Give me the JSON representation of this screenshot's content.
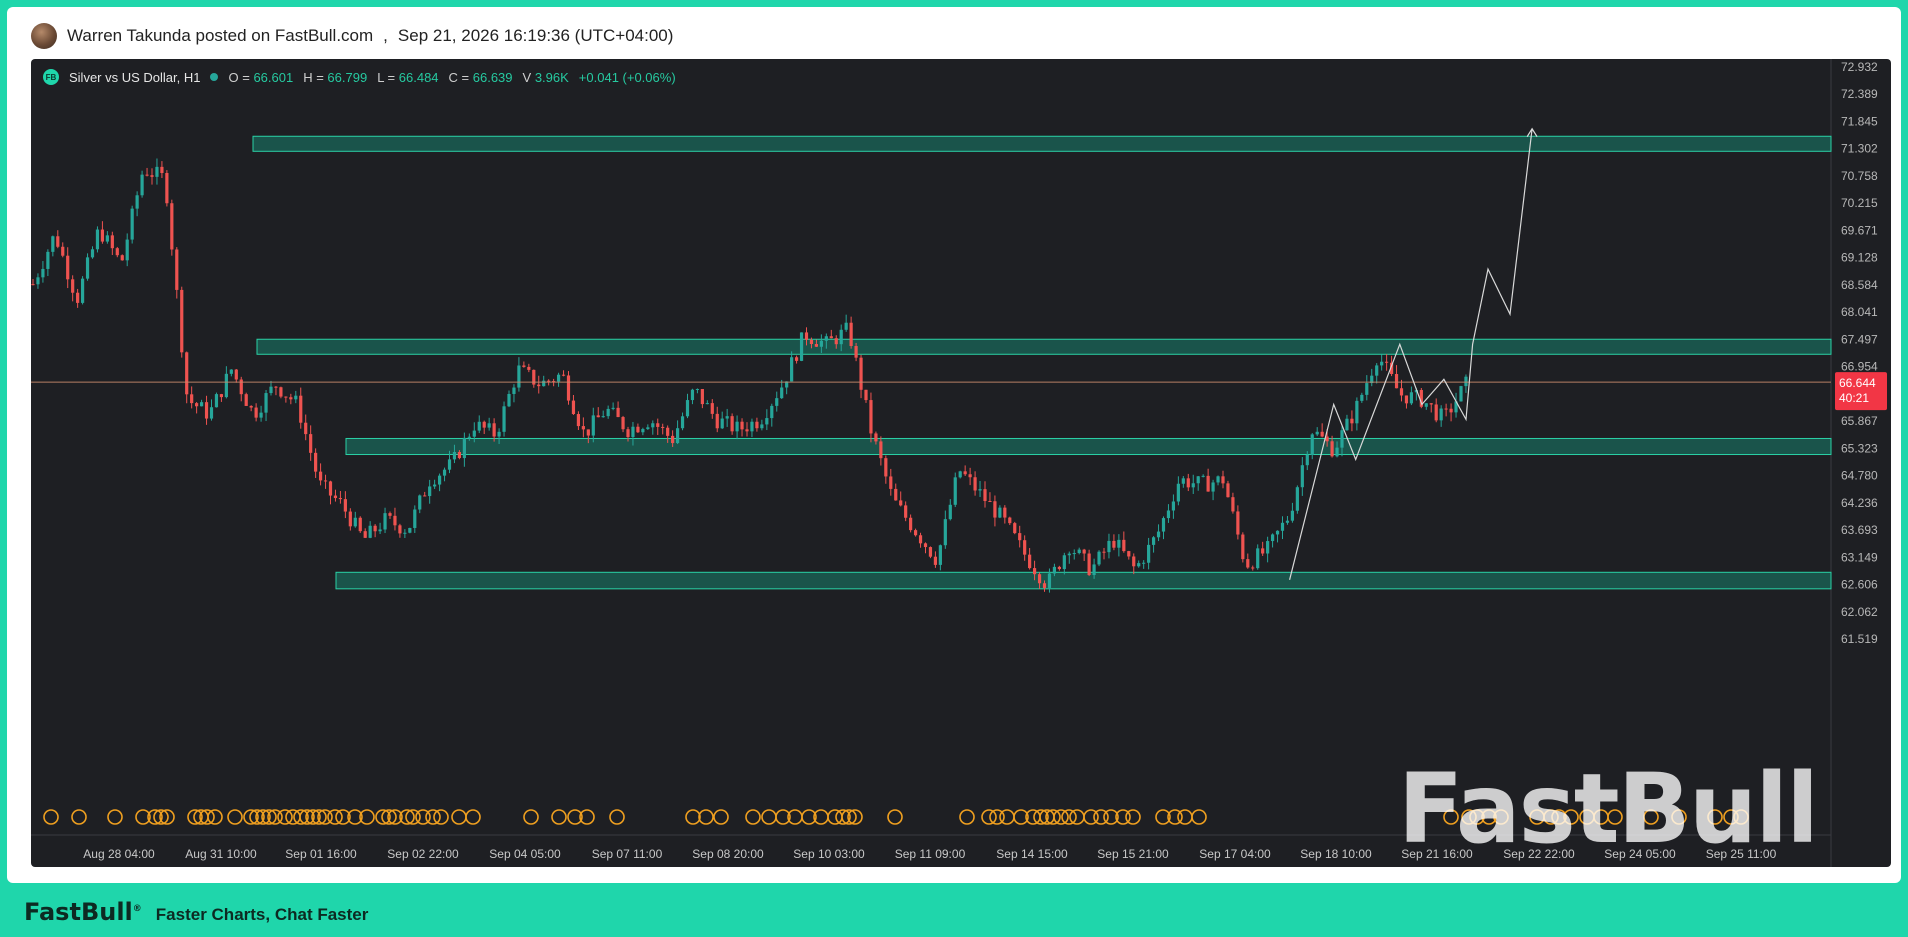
{
  "post": {
    "author_line": "Warren Takunda posted on FastBull.com",
    "separator": ",",
    "timestamp": "Sep 21, 2026 16:19:36 (UTC+04:00)"
  },
  "legend": {
    "badge": "FB",
    "symbol": "Silver vs US Dollar, H1",
    "o_label": "O =",
    "o_value": "66.601",
    "h_label": "H =",
    "h_value": "66.799",
    "l_label": "L =",
    "l_value": "66.484",
    "c_label": "C =",
    "c_value": "66.639",
    "v_label": "V",
    "v_value": "3.96K",
    "change": "+0.041 (+0.06%)"
  },
  "price_badge": {
    "price": "66.644",
    "countdown": "40:21",
    "color": "#f23645"
  },
  "watermark": "FastBull",
  "footer": {
    "logo": "FastBull",
    "logo_mark": "®",
    "tagline": "Faster Charts, Chat Faster"
  },
  "colors": {
    "up": "#26a69a",
    "down": "#ef5350",
    "zone_fill": "#1a5e52",
    "zone_stroke": "#2ad1a6",
    "event_icon": "#f0a020",
    "background": "#1e1f23"
  },
  "chart_data": {
    "type": "candlestick",
    "title": "Silver vs US Dollar, H1",
    "y_ticks": [
      "72.932",
      "72.389",
      "71.845",
      "71.302",
      "70.758",
      "70.215",
      "69.671",
      "69.128",
      "68.584",
      "68.041",
      "67.497",
      "66.954",
      "65.867",
      "65.323",
      "64.780",
      "64.236",
      "63.693",
      "63.149",
      "62.606",
      "62.062",
      "61.519"
    ],
    "ylim": [
      61.2,
      73.0
    ],
    "x_labels": [
      "Aug 28 04:00",
      "Aug 31 10:00",
      "Sep 01 16:00",
      "Sep 02 22:00",
      "Sep 04 05:00",
      "Sep 07 11:00",
      "Sep 08 20:00",
      "Sep 10 03:00",
      "Sep 11 09:00",
      "Sep 14 15:00",
      "Sep 15 21:00",
      "Sep 17 04:00",
      "Sep 18 10:00",
      "Sep 21 16:00",
      "Sep 22 22:00",
      "Sep 24 05:00",
      "Sep 25 11:00"
    ],
    "last_ohlc": {
      "open": 66.601,
      "high": 66.799,
      "low": 66.484,
      "close": 66.639
    },
    "current_price": 66.644,
    "price_path": [
      {
        "x": 0,
        "y": 68.6
      },
      {
        "x": 1,
        "y": 69.6
      },
      {
        "x": 2,
        "y": 68.3
      },
      {
        "x": 3,
        "y": 69.7
      },
      {
        "x": 4,
        "y": 69.0
      },
      {
        "x": 5,
        "y": 70.9
      },
      {
        "x": 6,
        "y": 70.7
      },
      {
        "x": 7,
        "y": 66.3
      },
      {
        "x": 8,
        "y": 66.0
      },
      {
        "x": 9,
        "y": 66.9
      },
      {
        "x": 10,
        "y": 66.0
      },
      {
        "x": 11,
        "y": 66.6
      },
      {
        "x": 12,
        "y": 66.2
      },
      {
        "x": 13,
        "y": 64.6
      },
      {
        "x": 14,
        "y": 64.2
      },
      {
        "x": 15,
        "y": 63.5
      },
      {
        "x": 16,
        "y": 63.9
      },
      {
        "x": 17,
        "y": 63.7
      },
      {
        "x": 18,
        "y": 64.7
      },
      {
        "x": 19,
        "y": 65.0
      },
      {
        "x": 20,
        "y": 65.8
      },
      {
        "x": 21,
        "y": 65.6
      },
      {
        "x": 22,
        "y": 66.9
      },
      {
        "x": 23,
        "y": 66.6
      },
      {
        "x": 24,
        "y": 66.8
      },
      {
        "x": 25,
        "y": 65.6
      },
      {
        "x": 26,
        "y": 66.1
      },
      {
        "x": 27,
        "y": 65.7
      },
      {
        "x": 28,
        "y": 65.9
      },
      {
        "x": 29,
        "y": 65.5
      },
      {
        "x": 30,
        "y": 66.5
      },
      {
        "x": 31,
        "y": 65.9
      },
      {
        "x": 32,
        "y": 65.7
      },
      {
        "x": 33,
        "y": 65.9
      },
      {
        "x": 34,
        "y": 66.6
      },
      {
        "x": 35,
        "y": 67.6
      },
      {
        "x": 36,
        "y": 67.4
      },
      {
        "x": 37,
        "y": 67.7
      },
      {
        "x": 38,
        "y": 65.7
      },
      {
        "x": 39,
        "y": 64.3
      },
      {
        "x": 40,
        "y": 63.7
      },
      {
        "x": 41,
        "y": 63.1
      },
      {
        "x": 42,
        "y": 64.9
      },
      {
        "x": 43,
        "y": 64.4
      },
      {
        "x": 44,
        "y": 63.9
      },
      {
        "x": 45,
        "y": 63.2
      },
      {
        "x": 46,
        "y": 62.6
      },
      {
        "x": 47,
        "y": 63.4
      },
      {
        "x": 48,
        "y": 62.9
      },
      {
        "x": 49,
        "y": 63.5
      },
      {
        "x": 50,
        "y": 62.9
      },
      {
        "x": 51,
        "y": 63.6
      },
      {
        "x": 52,
        "y": 64.7
      },
      {
        "x": 53,
        "y": 64.6
      },
      {
        "x": 54,
        "y": 64.7
      },
      {
        "x": 55,
        "y": 63.0
      },
      {
        "x": 56,
        "y": 63.3
      },
      {
        "x": 57,
        "y": 64.0
      },
      {
        "x": 58,
        "y": 65.7
      },
      {
        "x": 59,
        "y": 65.3
      },
      {
        "x": 60,
        "y": 66.1
      },
      {
        "x": 61,
        "y": 67.2
      },
      {
        "x": 62,
        "y": 66.4
      },
      {
        "x": 63,
        "y": 66.3
      },
      {
        "x": 64,
        "y": 65.9
      },
      {
        "x": 65,
        "y": 66.6
      }
    ],
    "zones": [
      {
        "low": 71.25,
        "high": 71.55
      },
      {
        "low": 67.2,
        "high": 67.5
      },
      {
        "low": 65.2,
        "high": 65.52
      },
      {
        "low": 62.52,
        "high": 62.85
      }
    ],
    "projection": [
      {
        "x": 57,
        "y": 62.7
      },
      {
        "x": 59,
        "y": 66.2
      },
      {
        "x": 60,
        "y": 65.1
      },
      {
        "x": 62,
        "y": 67.4
      },
      {
        "x": 63,
        "y": 66.2
      },
      {
        "x": 64,
        "y": 66.7
      },
      {
        "x": 65,
        "y": 65.9
      },
      {
        "x": 65.3,
        "y": 67.4
      },
      {
        "x": 66,
        "y": 68.9
      },
      {
        "x": 67,
        "y": 68.0
      },
      {
        "x": 68,
        "y": 71.7
      }
    ]
  }
}
